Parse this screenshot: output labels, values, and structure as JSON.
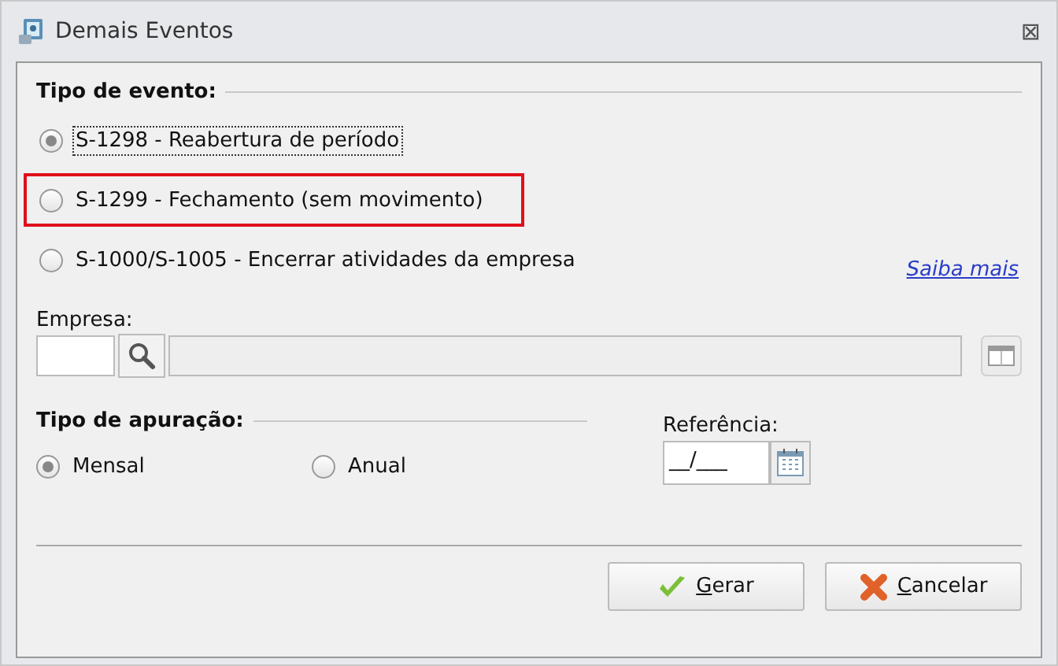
{
  "window": {
    "title": "Demais Eventos",
    "close": "⊠"
  },
  "event_type": {
    "heading": "Tipo de evento:",
    "options": [
      {
        "label": "S-1298 - Reabertura de período",
        "selected": true,
        "focused": true,
        "highlighted": false
      },
      {
        "label": "S-1299 - Fechamento (sem movimento)",
        "selected": false,
        "focused": false,
        "highlighted": true
      },
      {
        "label": "S-1000/S-1005 - Encerrar atividades da empresa",
        "selected": false,
        "focused": false,
        "highlighted": false
      }
    ],
    "link": "Saiba mais"
  },
  "empresa": {
    "label": "Empresa:"
  },
  "apuracao": {
    "heading": "Tipo de apuração:",
    "options": [
      {
        "label": "Mensal",
        "selected": true
      },
      {
        "label": "Anual",
        "selected": false
      }
    ]
  },
  "referencia": {
    "label": "Referência:",
    "value": "__/___"
  },
  "buttons": [
    {
      "kind": "ok",
      "label": "Gerar"
    },
    {
      "kind": "cancel",
      "label": "Cancelar"
    }
  ]
}
